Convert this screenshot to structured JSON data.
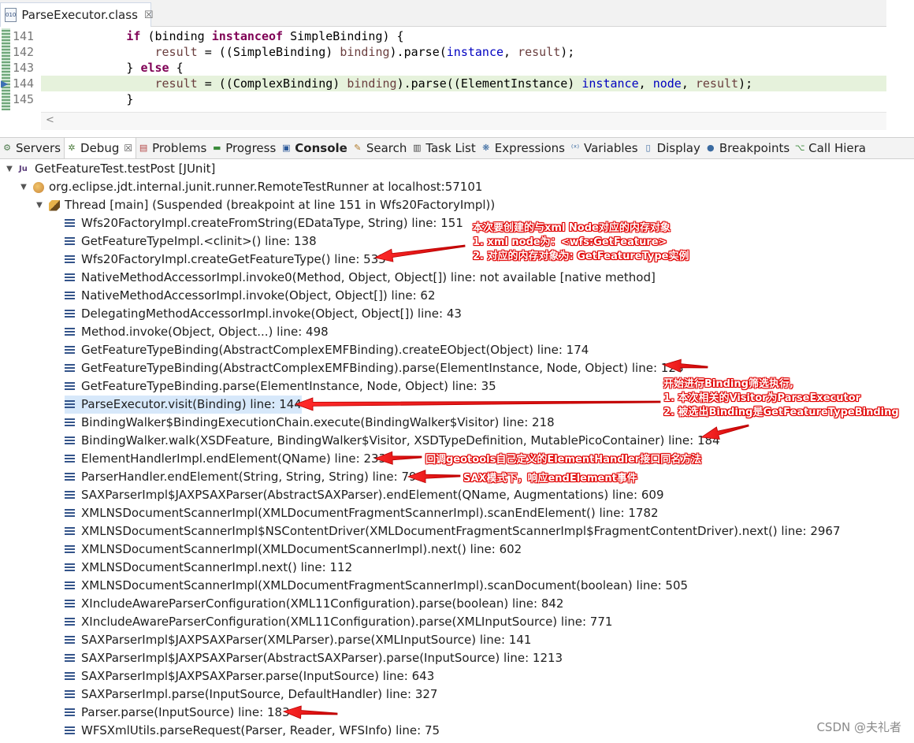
{
  "editor": {
    "tab_title": "ParseExecutor.class",
    "file_icon_text": "010",
    "close_glyph": "☒",
    "lines": [
      {
        "num": "141",
        "tokens": [
          {
            "t": "            ",
            "c": ""
          },
          {
            "t": "if",
            "c": "kw"
          },
          {
            "t": " (binding ",
            "c": ""
          },
          {
            "t": "instanceof",
            "c": "kw"
          },
          {
            "t": " SimpleBinding) {",
            "c": ""
          }
        ]
      },
      {
        "num": "142",
        "tokens": [
          {
            "t": "                ",
            "c": ""
          },
          {
            "t": "result",
            "c": "var"
          },
          {
            "t": " = ((SimpleBinding) ",
            "c": ""
          },
          {
            "t": "binding",
            "c": "var"
          },
          {
            "t": ").parse(",
            "c": ""
          },
          {
            "t": "instance",
            "c": "fld"
          },
          {
            "t": ", ",
            "c": ""
          },
          {
            "t": "result",
            "c": "var"
          },
          {
            "t": ");",
            "c": ""
          }
        ]
      },
      {
        "num": "143",
        "tokens": [
          {
            "t": "            } ",
            "c": ""
          },
          {
            "t": "else",
            "c": "kw"
          },
          {
            "t": " {",
            "c": ""
          }
        ]
      },
      {
        "num": "144",
        "highlight": true,
        "tokens": [
          {
            "t": "                ",
            "c": ""
          },
          {
            "t": "result",
            "c": "var"
          },
          {
            "t": " = ((ComplexBinding) ",
            "c": ""
          },
          {
            "t": "binding",
            "c": "var"
          },
          {
            "t": ").parse((ElementInstance) ",
            "c": ""
          },
          {
            "t": "instance",
            "c": "fld"
          },
          {
            "t": ", ",
            "c": ""
          },
          {
            "t": "node",
            "c": "fld"
          },
          {
            "t": ", ",
            "c": ""
          },
          {
            "t": "result",
            "c": "var"
          },
          {
            "t": ");",
            "c": ""
          }
        ]
      },
      {
        "num": "145",
        "tokens": [
          {
            "t": "            }",
            "c": ""
          }
        ]
      }
    ]
  },
  "views": [
    {
      "label": "Servers",
      "icon": "servers-icon",
      "glyph": "⚙",
      "color": "#4d7a4d"
    },
    {
      "label": "Debug",
      "icon": "debug-bug-icon",
      "glyph": "✲",
      "color": "#4a7a3a",
      "active": true,
      "close": "☒"
    },
    {
      "label": "Problems",
      "icon": "problems-icon",
      "glyph": "▤",
      "color": "#b04040"
    },
    {
      "label": "Progress",
      "icon": "progress-icon",
      "glyph": "▬",
      "color": "#3a8a3a"
    },
    {
      "label": "Console",
      "icon": "console-icon",
      "glyph": "▣",
      "color": "#2d5a9a",
      "bold": true
    },
    {
      "label": "Search",
      "icon": "search-icon",
      "glyph": "✎",
      "color": "#b07a2a"
    },
    {
      "label": "Task List",
      "icon": "task-list-icon",
      "glyph": "▥",
      "color": "#444"
    },
    {
      "label": "Expressions",
      "icon": "expressions-icon",
      "glyph": "❋",
      "color": "#3a6aa0"
    },
    {
      "label": "Variables",
      "icon": "variables-icon",
      "glyph": "⁽ˣ⁾",
      "color": "#3a6aa0"
    },
    {
      "label": "Display",
      "icon": "display-icon",
      "glyph": "▯",
      "color": "#3a6aa0"
    },
    {
      "label": "Breakpoints",
      "icon": "breakpoints-icon",
      "glyph": "●",
      "color": "#3a6aa0"
    },
    {
      "label": "Call Hiera",
      "icon": "call-hierarchy-icon",
      "glyph": "⌥",
      "color": "#3a8a3a"
    }
  ],
  "tree": {
    "launch": "GetFeatureTest.testPost [JUnit]",
    "launch_icon_text": "Ju",
    "runner": "org.eclipse.jdt.internal.junit.runner.RemoteTestRunner at localhost:57101",
    "thread": "Thread [main] (Suspended (breakpoint at line 151 in Wfs20FactoryImpl))",
    "frames": [
      "Wfs20FactoryImpl.createFromString(EDataType, String) line: 151",
      "GetFeatureTypeImpl.<clinit>() line: 138",
      "Wfs20FactoryImpl.createGetFeatureType() line: 535",
      "NativeMethodAccessorImpl.invoke0(Method, Object, Object[]) line: not available [native method]",
      "NativeMethodAccessorImpl.invoke(Object, Object[]) line: 62",
      "DelegatingMethodAccessorImpl.invoke(Object, Object[]) line: 43",
      "Method.invoke(Object, Object...) line: 498",
      "GetFeatureTypeBinding(AbstractComplexEMFBinding).createEObject(Object) line: 174",
      "GetFeatureTypeBinding(AbstractComplexEMFBinding).parse(ElementInstance, Node, Object) line: 128",
      "GetFeatureTypeBinding.parse(ElementInstance, Node, Object) line: 35",
      "ParseExecutor.visit(Binding) line: 144",
      "BindingWalker$BindingExecutionChain.execute(BindingWalker$Visitor) line: 218",
      "BindingWalker.walk(XSDFeature, BindingWalker$Visitor, XSDTypeDefinition, MutablePicoContainer) line: 184",
      "ElementHandlerImpl.endElement(QName) line: 233",
      "ParserHandler.endElement(String, String, String) line: 794",
      "SAXParserImpl$JAXPSAXParser(AbstractSAXParser).endElement(QName, Augmentations) line: 609",
      "XMLNSDocumentScannerImpl(XMLDocumentFragmentScannerImpl).scanEndElement() line: 1782",
      "XMLNSDocumentScannerImpl$NSContentDriver(XMLDocumentFragmentScannerImpl$FragmentContentDriver).next() line: 2967",
      "XMLNSDocumentScannerImpl(XMLDocumentScannerImpl).next() line: 602",
      "XMLNSDocumentScannerImpl.next() line: 112",
      "XMLNSDocumentScannerImpl(XMLDocumentFragmentScannerImpl).scanDocument(boolean) line: 505",
      "XIncludeAwareParserConfiguration(XML11Configuration).parse(boolean) line: 842",
      "XIncludeAwareParserConfiguration(XML11Configuration).parse(XMLInputSource) line: 771",
      "SAXParserImpl$JAXPSAXParser(XMLParser).parse(XMLInputSource) line: 141",
      "SAXParserImpl$JAXPSAXParser(AbstractSAXParser).parse(InputSource) line: 1213",
      "SAXParserImpl$JAXPSAXParser.parse(InputSource) line: 643",
      "SAXParserImpl.parse(InputSource, DefaultHandler) line: 327",
      "Parser.parse(InputSource) line: 183",
      "WFSXmlUtils.parseRequest(Parser, Reader, WFSInfo) line: 75"
    ],
    "selected_index": 10
  },
  "annotations": {
    "note1": [
      "本次要创建的与xml Node对应的内存对象",
      "1. xml node为：<wfs:GetFeature>",
      "2. 对应的内存对象为: GetFeatureType实例"
    ],
    "note2": [
      "开始进行Binding筛选执行,",
      "1. 本次相关的Visitor为ParseExecutor",
      "2. 被选出Binding是GetFeatureTypeBinding"
    ],
    "note3": "回调geotools自己定义的ElementHandler接口同名方法",
    "note4": "SAX模式下，响应endElement事件",
    "arrow_color": "#e00000"
  },
  "watermark": "CSDN @夫礼者"
}
